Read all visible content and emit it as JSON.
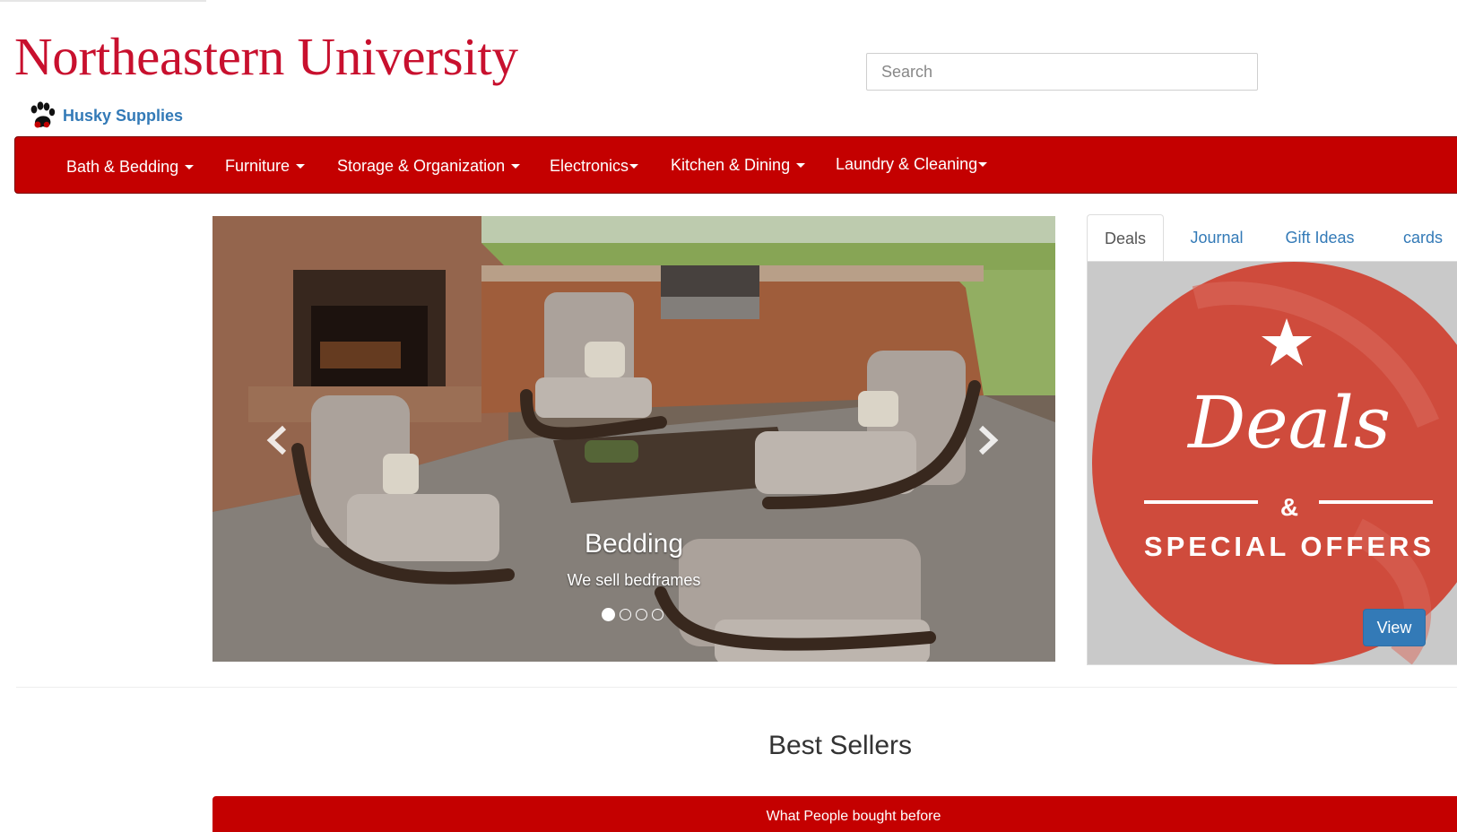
{
  "header": {
    "logo_text": "Northeastern University",
    "brand_link": "Husky Supplies",
    "search_placeholder": "Search"
  },
  "nav": {
    "items": [
      {
        "label": "Bath & Bedding",
        "has_caret": true
      },
      {
        "label": "Furniture",
        "has_caret": true
      },
      {
        "label": "Storage & Organization",
        "has_caret": true
      },
      {
        "label": "Electronics",
        "has_caret": true
      },
      {
        "label": "Kitchen & Dining",
        "has_caret": true
      },
      {
        "label": "Laundry & Cleaning",
        "has_caret": true
      }
    ],
    "background": "#c40000"
  },
  "carousel": {
    "caption_title": "Bedding",
    "caption_text": "We sell bedframes",
    "slide_count": 4,
    "active_index": 0,
    "prev_icon": "chevron-left-icon",
    "next_icon": "chevron-right-icon"
  },
  "side_tabs": {
    "tabs": [
      {
        "label": "Deals",
        "active": true
      },
      {
        "label": "Journal",
        "active": false
      },
      {
        "label": "Gift Ideas",
        "active": false
      },
      {
        "label": "cards",
        "active": false
      }
    ]
  },
  "deals_panel": {
    "title": "Deals",
    "amp": "&",
    "subtitle": "SPECIAL OFFERS",
    "button_label": "View",
    "badge_color": "#cf4b3c",
    "icon": "star-icon"
  },
  "best_sellers": {
    "heading": "Best Sellers",
    "bar_text": "What People bought before"
  },
  "colors": {
    "brand_red": "#c8102e",
    "link_blue": "#337ab7"
  }
}
